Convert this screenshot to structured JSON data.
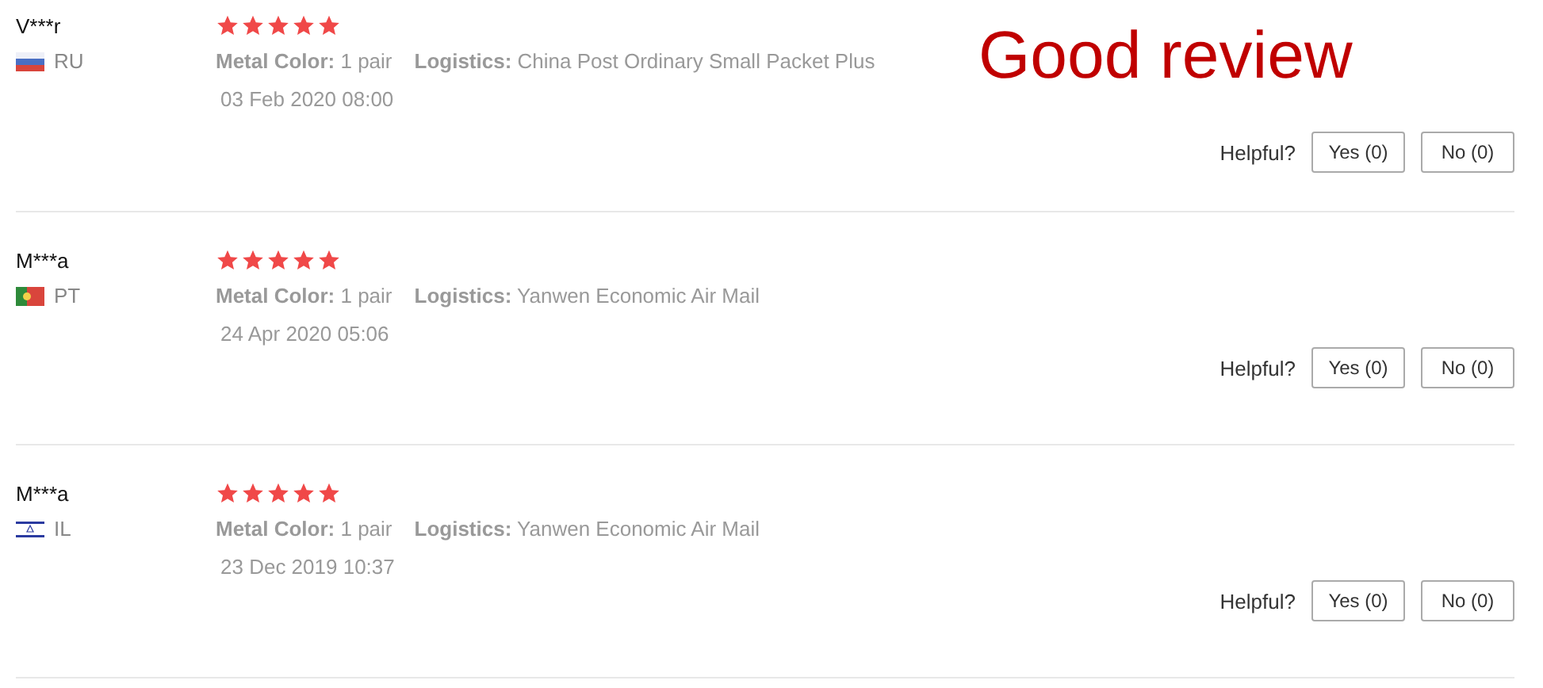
{
  "annotation": "Good review",
  "reviews": [
    {
      "name": "V***r",
      "kind": "ru",
      "country": "RU",
      "stars": 5,
      "color_label": "Metal Color:",
      "color_value": "1 pair",
      "logistics_label": "Logistics:",
      "logistics_value": "China Post Ordinary Small Packet Plus",
      "date": "03 Feb 2020 08:00",
      "helpful": "Helpful?",
      "yes": "Yes (0)",
      "no": "No (0)"
    },
    {
      "name": "M***a",
      "kind": "pt",
      "country": "PT",
      "stars": 5,
      "color_label": "Metal Color:",
      "color_value": "1 pair",
      "logistics_label": "Logistics:",
      "logistics_value": "Yanwen Economic Air Mail",
      "date": "24 Apr 2020 05:06",
      "helpful": "Helpful?",
      "yes": "Yes (0)",
      "no": "No (0)"
    },
    {
      "name": "M***a",
      "kind": "il",
      "country": "IL",
      "stars": 5,
      "color_label": "Metal Color:",
      "color_value": "1 pair",
      "logistics_label": "Logistics:",
      "logistics_value": "Yanwen Economic Air Mail",
      "date": "23 Dec 2019 10:37",
      "helpful": "Helpful?",
      "yes": "Yes (0)",
      "no": "No (0)"
    }
  ]
}
